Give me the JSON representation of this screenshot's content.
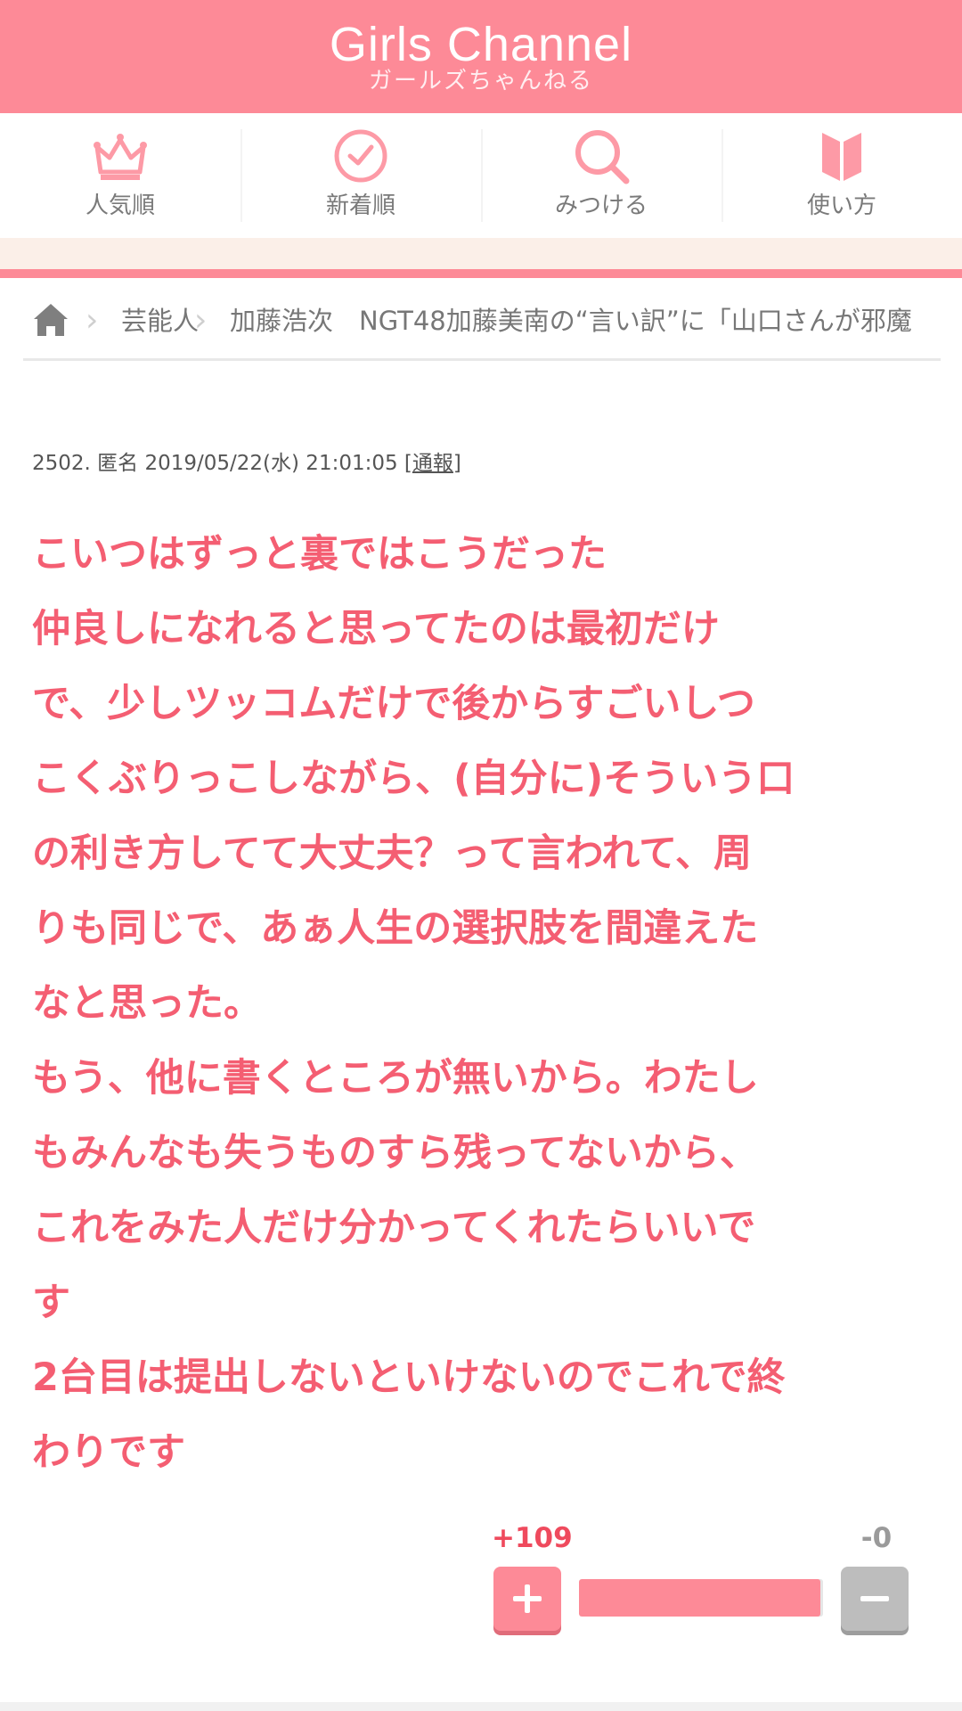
{
  "header": {
    "logo_en": "Girls Channel",
    "logo_jp": "ガールズちゃんねる",
    "bg_color": "#fd8a97"
  },
  "nav": {
    "items": [
      {
        "label": "人気順",
        "icon": "crown-icon"
      },
      {
        "label": "新着順",
        "icon": "clock-icon"
      },
      {
        "label": "みつける",
        "icon": "search-icon"
      },
      {
        "label": "使い方",
        "icon": "book-icon"
      }
    ]
  },
  "breadcrumb": {
    "home_icon": "home-icon",
    "items": [
      "芸能人",
      "加藤浩次　NGT48加藤美南の“言い訳”に「山口さんが邪魔"
    ]
  },
  "comment": {
    "number": "2502.",
    "author": "匿名",
    "datetime": "2019/05/22(水) 21:01:05",
    "report_open": "[",
    "report_label": "通報",
    "report_close": "]",
    "lines": [
      "こいつはずっと裏ではこうだった",
      "仲良しになれると思ってたのは最初だけ",
      "で、少しツッコムだけで後からすごいしつ",
      "こくぶりっこしながら、(自分に)そういう口",
      "の利き方してて大丈夫？って言われて、周",
      "りも同じで、あぁ人生の選択肢を間違えた",
      "なと思った。",
      "もう、他に書くところが無いから。わたし",
      "もみんなも失うものすら残ってないから、",
      "これをみた人だけ分かってくれたらいいで",
      "す",
      "2台目は提出しないといけないのでこれで終",
      "わりです"
    ],
    "text_color": "#f45e72"
  },
  "votes": {
    "plus": "+109",
    "minus": "-0",
    "plus_ratio": 0.99
  }
}
